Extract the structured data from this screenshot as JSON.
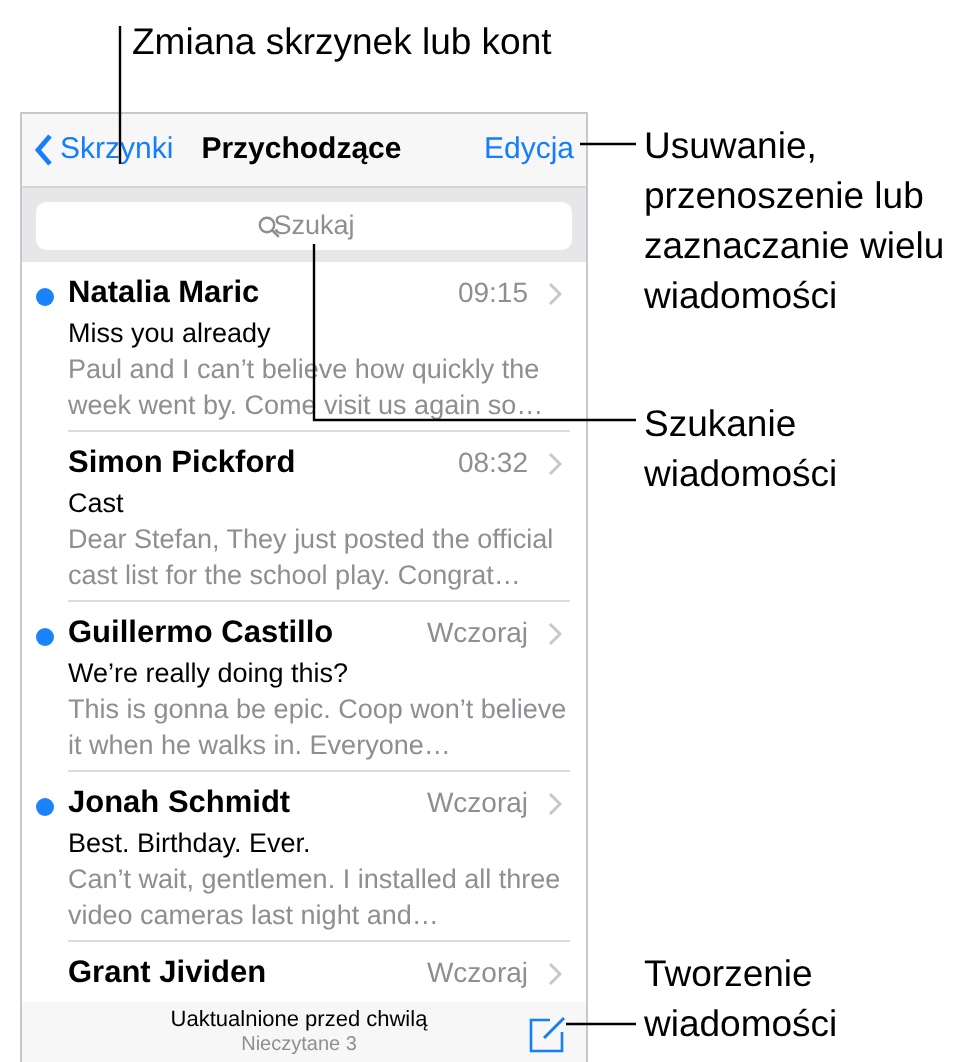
{
  "annotations": [
    {
      "kind": "top",
      "text": "Zmiana skrzynek lub kont"
    },
    {
      "kind": "edit",
      "text": "Usuwanie, przenoszenie lub zaznaczanie wielu wiadomości"
    },
    {
      "kind": "search",
      "text": "Szukanie wiadomości"
    },
    {
      "kind": "compose",
      "text": "Tworzenie wiadomości"
    }
  ],
  "nav": {
    "back": "Skrzynki",
    "title": "Przychodzące",
    "edit": "Edycja"
  },
  "search": {
    "placeholder": "Szukaj"
  },
  "messages": [
    {
      "sender": "Natalia Maric",
      "time": "09:15",
      "subject": "Miss you already",
      "preview": "Paul and I can’t believe how quickly the week went by. Come visit us again so…",
      "unread": true
    },
    {
      "sender": "Simon Pickford",
      "time": "08:32",
      "subject": "Cast",
      "preview": "Dear Stefan, They just posted the official cast list for the school play. Congrat…",
      "unread": false
    },
    {
      "sender": "Guillermo Castillo",
      "time": "Wczoraj",
      "subject": "We’re really doing this?",
      "preview": "This is gonna be epic. Coop won’t believe it when he walks in. Everyone…",
      "unread": true
    },
    {
      "sender": "Jonah Schmidt",
      "time": "Wczoraj",
      "subject": "Best. Birthday. Ever.",
      "preview": "Can’t wait, gentlemen. I installed all three video cameras last night and…",
      "unread": true
    },
    {
      "sender": "Grant Jividen",
      "time": "Wczoraj",
      "unread": false
    }
  ],
  "toolbar": {
    "status": "Uaktualnione przed chwilą",
    "unread_count": "Nieczytane 3"
  }
}
